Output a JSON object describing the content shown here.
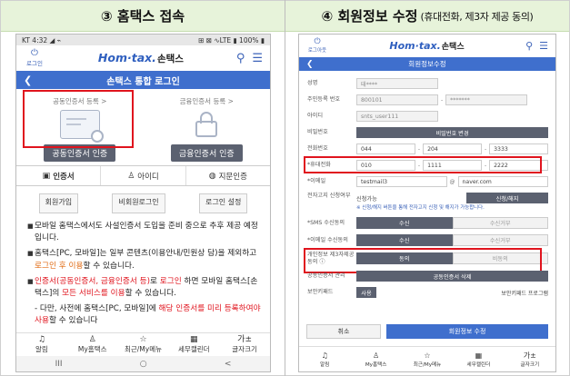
{
  "left_panel": {
    "header_title": "③ 홈택스 접속",
    "status_bar": {
      "left": "KT 4:32 ◢ ⌁",
      "right": "⊞ ⊠ ∿LTE ▮ 100% ▮"
    },
    "app_header": {
      "login_label": "로그인",
      "logo_main": "Hom·tax.",
      "logo_sub": "손택스"
    },
    "title_bar": "손택스 통합 로그인",
    "certs": [
      {
        "register": "공동인증서 등록 >",
        "button": "공동인증서 인증"
      },
      {
        "register": "금융인증서 등록 >",
        "button": "금융인증서 인증"
      }
    ],
    "tabs": [
      {
        "icon": "▣",
        "label": "인증서"
      },
      {
        "icon": "♙",
        "label": "아이디"
      },
      {
        "icon": "◍",
        "label": "지문인증"
      }
    ],
    "options": [
      "회원가입",
      "비회원로그인",
      "로그인 설정"
    ],
    "notice": {
      "p1": "모바일 홈택스에서도 사설인증서 도입을 준비 중으로 추후 제공 예정입니다.",
      "p2_a": "홈택스[PC, 모바일]는 일부 콘텐츠(이용안내/민원상 담",
      "p2_b": ")을 제외하고 ",
      "p2_c": "로그인 후 이용",
      "p2_d": "할 수 있습니다.",
      "p3_a": "인증서(공동인증서, 금융인증서 등)",
      "p3_b": "로 ",
      "p3_c": "로그인",
      "p3_d": " 하면 모바일 홈택스[손택스]의 ",
      "p3_e": "모든 서비스를 이용",
      "p3_f": "할 수 있습니다.",
      "p4_a": "- 다만, 사전에 홈택스[PC, 모바일]에 ",
      "p4_b": "해당 인증서를 미리 등록하여야 사용",
      "p4_c": "할 수 있습니다"
    },
    "bottom_nav": [
      {
        "icon": "♫",
        "label": "알림"
      },
      {
        "icon": "♙",
        "label": "My홈택스"
      },
      {
        "icon": "☆",
        "label": "최근/My메뉴"
      },
      {
        "icon": "▦",
        "label": "세무캘린더"
      },
      {
        "icon": "가±",
        "label": "글자크기"
      }
    ],
    "android_bar": [
      "III",
      "○",
      "<"
    ]
  },
  "right_panel": {
    "header_title": "④ 회원정보 수정",
    "header_sub": "(휴대전화, 제3자 제공 동의)",
    "app_header": {
      "login_label": "로그아웃",
      "logo_main": "Hom·tax.",
      "logo_sub": "손택스"
    },
    "title_bar": "회원정보수정",
    "form": {
      "name_label": "성명",
      "name_value": "태****",
      "rrn_label": "주민등록 번호",
      "rrn_front": "800101",
      "rrn_back": "*******",
      "id_label": "아이디",
      "id_value": "snts_user111",
      "pw_label": "비밀번호",
      "pw_button": "비밀번호 변경",
      "tel_label": "전화번호",
      "tel": [
        "044",
        "204",
        "3333"
      ],
      "mobile_label": "*휴대전화",
      "mobile": [
        "010",
        "1111",
        "2222"
      ],
      "email_label": "*이메일",
      "email_id": "testmail3",
      "email_at": "@",
      "email_domain": "naver.com",
      "einvoice_label": "전자고지 신청여부",
      "einvoice_status": "신청가능",
      "einvoice_button": "신청/해지",
      "einvoice_note": "※ 신청/해지 버튼을 통해 전자고지 신청 및 해지가 가능합니다.",
      "sms_label": "*SMS 수신동의",
      "sms_on": "수신",
      "sms_off": "수신거부",
      "mail_label": "*이메일 수신동의",
      "mail_on": "수신",
      "mail_off": "수신거부",
      "agree_label": "개인정보 제3자제공 동의 ⓘ",
      "agree_on": "동의",
      "agree_off": "비동의",
      "cert_label": "공동인증서 관리",
      "cert_button": "공동인증서 삭제",
      "keyboard_label": "보안키패드",
      "keyboard_toggle": "사용",
      "keyboard_link": "보안키패드 프로그램"
    },
    "cancel": "취소",
    "submit": "회원정보 수정",
    "bottom_nav": [
      {
        "icon": "♫",
        "label": "알림"
      },
      {
        "icon": "♙",
        "label": "My홈택스"
      },
      {
        "icon": "☆",
        "label": "최근/My메뉴"
      },
      {
        "icon": "▦",
        "label": "세무캘린더"
      },
      {
        "icon": "가±",
        "label": "글자크기"
      }
    ]
  },
  "colors": {
    "accent": "#3f6fcd",
    "highlight": "#e0141e",
    "header_bg": "#e7f3da",
    "dark_button": "#5b6170"
  }
}
